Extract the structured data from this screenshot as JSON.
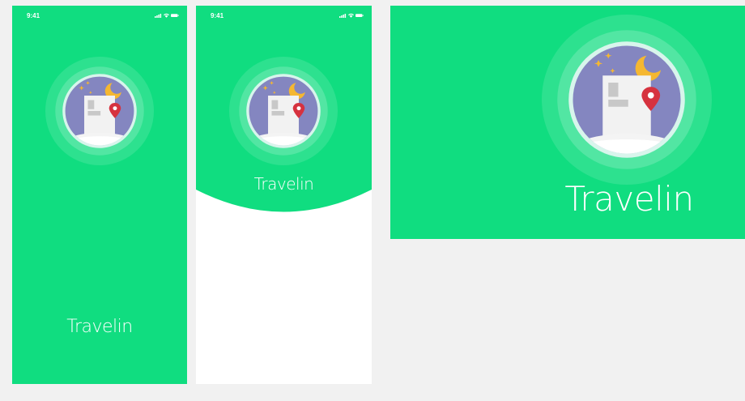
{
  "app": {
    "name": "Travelin"
  },
  "status_bar": {
    "time": "9:41"
  },
  "colors": {
    "brand_green": "#10dd80",
    "night_sky": "#8486c0",
    "moon": "#f5b731",
    "pin": "#d6323f",
    "canvas": "#f1f1f1"
  },
  "icons": {
    "logo": "night-building-with-location-pin",
    "signal": "cellular-signal-icon",
    "wifi": "wifi-icon",
    "battery": "battery-icon"
  }
}
